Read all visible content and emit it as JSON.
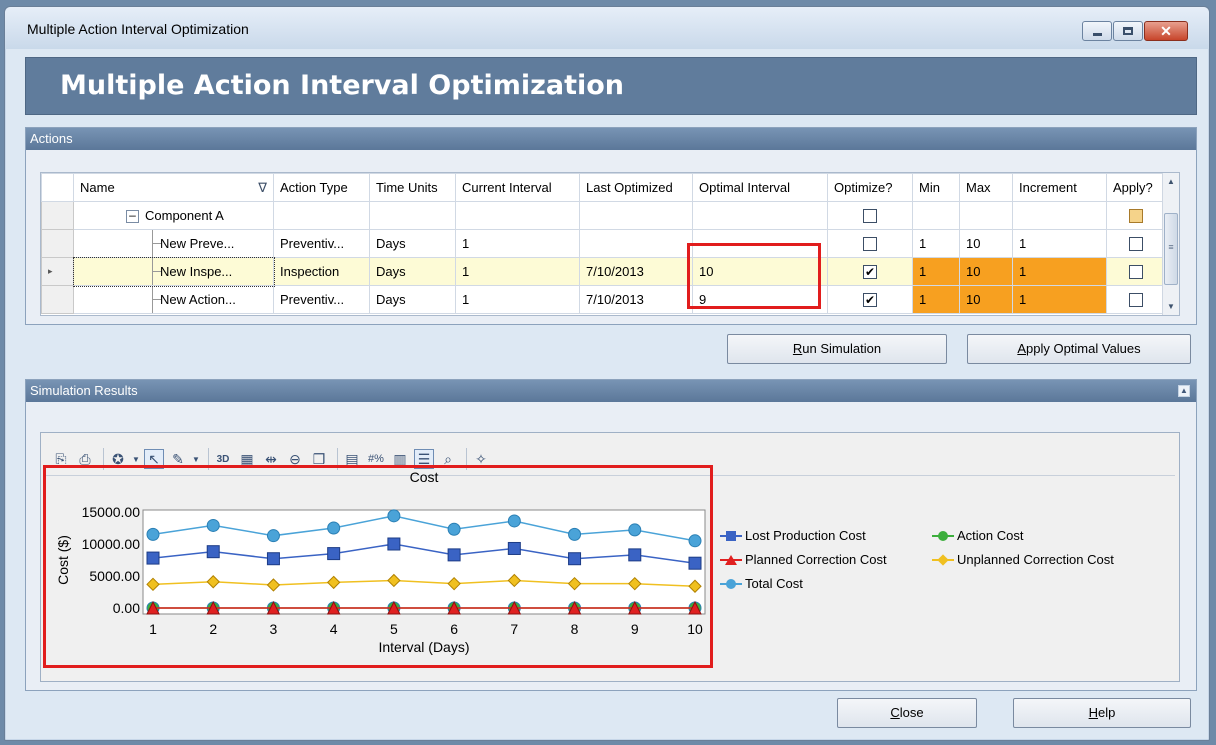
{
  "window": {
    "title": "Multiple Action Interval Optimization",
    "heading": "Multiple Action Interval Optimization"
  },
  "actions": {
    "panel_title": "Actions",
    "columns": [
      "Name",
      "Action Type",
      "Time Units",
      "Current Interval",
      "Last Optimized",
      "Optimal Interval",
      "Optimize?",
      "Min",
      "Max",
      "Increment",
      "Apply?"
    ],
    "filter_glyph": "∇",
    "rows": [
      {
        "name": "Component A",
        "action_type": "",
        "time_units": "",
        "current_interval": "",
        "last_optimized": "",
        "optimal_interval": "",
        "optimize": false,
        "min": "",
        "max": "",
        "increment": "",
        "apply": "partial"
      },
      {
        "name": "New Preve...",
        "action_type": "Preventiv...",
        "time_units": "Days",
        "current_interval": "1",
        "last_optimized": "",
        "optimal_interval": "",
        "optimize": false,
        "min": "1",
        "max": "10",
        "increment": "1",
        "apply": false
      },
      {
        "name": "New Inspe...",
        "action_type": "Inspection",
        "time_units": "Days",
        "current_interval": "1",
        "last_optimized": "7/10/2013",
        "optimal_interval": "10",
        "optimize": true,
        "min": "1",
        "max": "10",
        "increment": "1",
        "apply": false
      },
      {
        "name": "New Action...",
        "action_type": "Preventiv...",
        "time_units": "Days",
        "current_interval": "1",
        "last_optimized": "7/10/2013",
        "optimal_interval": "9",
        "optimize": true,
        "min": "1",
        "max": "10",
        "increment": "1",
        "apply": false
      }
    ]
  },
  "buttons": {
    "run_simulation": {
      "label": "Run Simulation",
      "mnemonic": "R",
      "rest": "un Simulation"
    },
    "apply_optimal": {
      "label": "Apply Optimal Values",
      "mnemonic": "A",
      "rest": "pply Optimal Values"
    },
    "close": {
      "label": "Close",
      "mnemonic": "C",
      "rest": "lose"
    },
    "help": {
      "label": "Help",
      "mnemonic": "H",
      "rest": "elp"
    }
  },
  "results": {
    "panel_title": "Simulation Results"
  },
  "colors": {
    "lost_production": "#3a63c4",
    "action": "#3cae3c",
    "planned": "#e02020",
    "unplanned": "#f0c020",
    "total": "#4aa3d8"
  },
  "chart_data": {
    "type": "line",
    "title": "Cost",
    "xlabel": "Interval (Days)",
    "ylabel": "Cost ($)",
    "x": [
      1,
      2,
      3,
      4,
      5,
      6,
      7,
      8,
      9,
      10
    ],
    "ylim": [
      0,
      15000
    ],
    "yticks": [
      "0.00",
      "5000.00",
      "10000.00",
      "15000.00"
    ],
    "legend_position": "right",
    "series": [
      {
        "name": "Lost Production Cost",
        "marker": "square",
        "color": "#3a63c4",
        "values": [
          7800,
          8800,
          7700,
          8500,
          10000,
          8300,
          9300,
          7700,
          8300,
          7000
        ]
      },
      {
        "name": "Action Cost",
        "marker": "circle",
        "color": "#3cae3c",
        "values": [
          0,
          0,
          0,
          0,
          0,
          0,
          0,
          0,
          0,
          0
        ]
      },
      {
        "name": "Planned Correction Cost",
        "marker": "triangle",
        "color": "#e02020",
        "values": [
          0,
          0,
          0,
          0,
          0,
          0,
          0,
          0,
          0,
          0
        ]
      },
      {
        "name": "Unplanned Correction Cost",
        "marker": "diamond",
        "color": "#f0c020",
        "values": [
          3700,
          4100,
          3600,
          4000,
          4300,
          3800,
          4300,
          3800,
          3800,
          3400
        ]
      },
      {
        "name": "Total Cost",
        "marker": "circle",
        "color": "#4aa3d8",
        "values": [
          11500,
          12900,
          11300,
          12500,
          14400,
          12300,
          13600,
          11500,
          12200,
          10500
        ]
      }
    ]
  }
}
